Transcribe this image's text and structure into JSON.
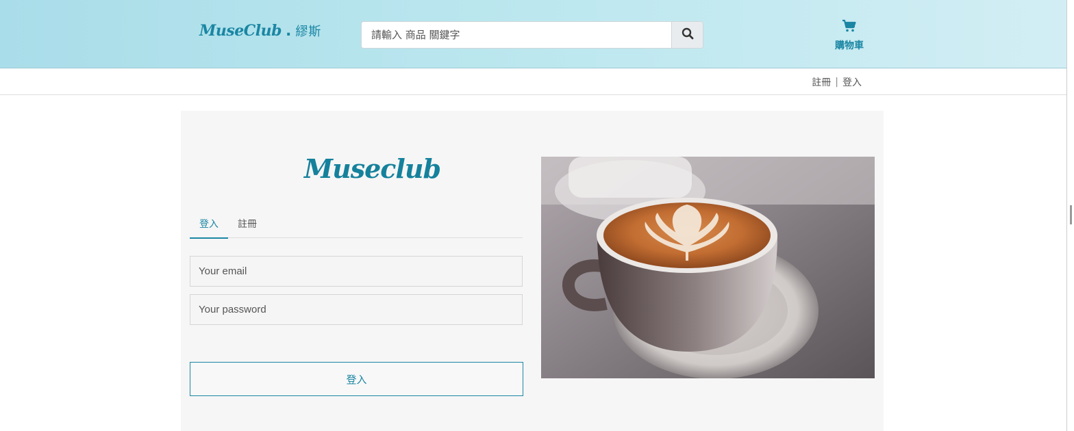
{
  "header": {
    "logo_script": "MuseClub",
    "logo_dot": ".",
    "logo_cn": "繆斯",
    "search_placeholder": "請輸入 商品 關鍵字",
    "search_icon": "search-icon",
    "cart_icon": "shopping-cart-icon",
    "cart_label": "購物車"
  },
  "subnav": {
    "register": "註冊",
    "separator": "|",
    "login": "登入"
  },
  "login_card": {
    "brand": "Museclub",
    "tabs": [
      {
        "label": "登入",
        "active": true
      },
      {
        "label": "註冊",
        "active": false
      }
    ],
    "email_placeholder": "Your email",
    "password_placeholder": "Your password",
    "submit_label": "登入"
  },
  "colors": {
    "accent": "#1a86a3",
    "header_bg": "#bce7ef",
    "card_bg": "#f6f6f6"
  }
}
